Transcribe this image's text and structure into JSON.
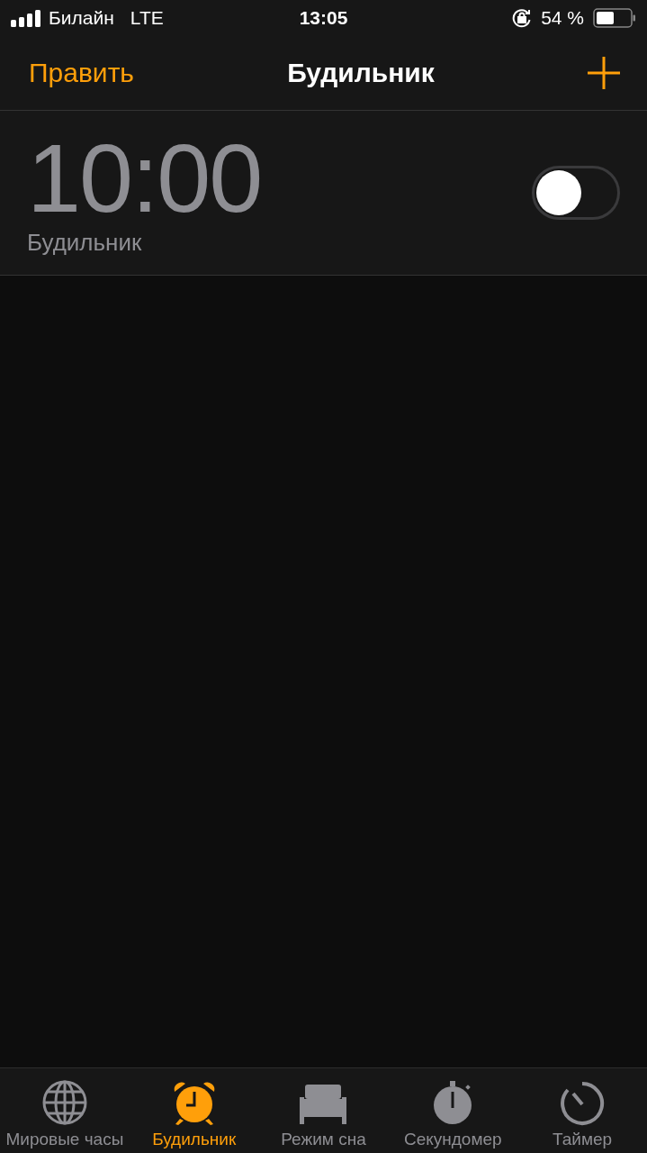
{
  "status_bar": {
    "carrier": "Билайн",
    "network": "LTE",
    "time": "13:05",
    "battery_text": "54 %"
  },
  "nav_bar": {
    "edit": "Править",
    "title": "Будильник"
  },
  "alarms": [
    {
      "time": "10:00",
      "label": "Будильник",
      "on": false
    }
  ],
  "tab_bar": [
    {
      "kind": "globe",
      "label": "Мировые часы",
      "selected": false
    },
    {
      "kind": "alarm",
      "label": "Будильник",
      "selected": true
    },
    {
      "kind": "bed",
      "label": "Режим сна",
      "selected": false
    },
    {
      "kind": "stopwatch",
      "label": "Секундомер",
      "selected": false
    },
    {
      "kind": "timer",
      "label": "Таймер",
      "selected": false
    }
  ]
}
